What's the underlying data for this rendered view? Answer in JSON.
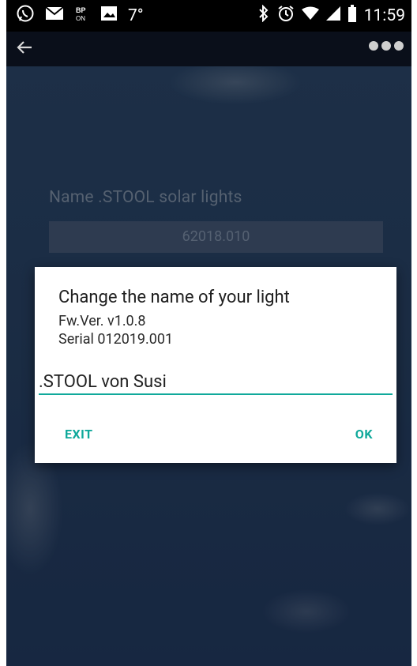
{
  "status_bar": {
    "temperature": "7°",
    "time": "11:59",
    "icons_left": [
      "whatsapp-icon",
      "mail-icon",
      "bp-on-icon",
      "image-icon"
    ],
    "icons_right": [
      "bluetooth-icon",
      "alarm-icon",
      "wifi-icon",
      "signal-icon",
      "battery-icon"
    ]
  },
  "toolbar": {
    "back_icon": "arrow-back-icon",
    "menu_icon": "more-options-icon"
  },
  "background_screen": {
    "name_label": "Name .STOOL solar lights",
    "serial_value": "62018.010"
  },
  "dialog": {
    "title": "Change the name of your light",
    "firmware": "Fw.Ver. v1.0.8",
    "serial": "Serial 012019.001",
    "input_value": ".STOOL von Susi",
    "exit_label": "EXIT",
    "ok_label": "OK",
    "accent_color": "#10a99b"
  }
}
